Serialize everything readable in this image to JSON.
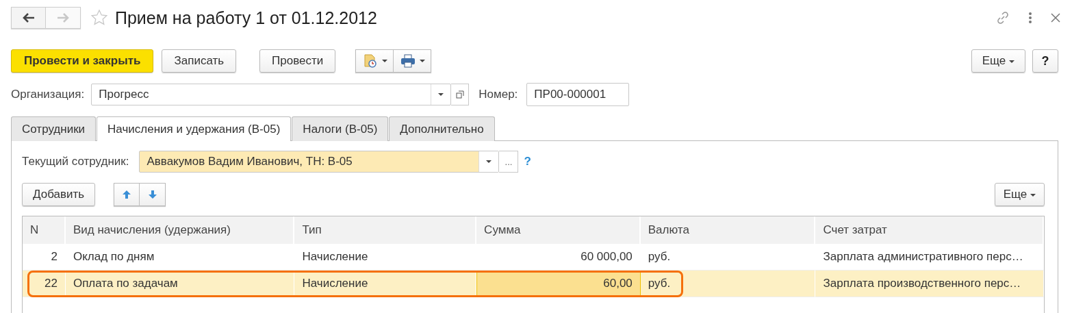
{
  "window": {
    "title": "Прием на работу 1 от 01.12.2012",
    "back_disabled": false,
    "forward_disabled": true,
    "favorite": false
  },
  "toolbar": {
    "buttons": [
      {
        "label": "Провести и закрыть",
        "kind": "primary"
      },
      {
        "label": "Записать",
        "kind": "normal"
      },
      {
        "label": "Провести",
        "kind": "normal"
      }
    ],
    "more": "Еще",
    "help": "?"
  },
  "organization": {
    "label": "Организация:",
    "value": "Прогресс"
  },
  "number": {
    "label": "Номер:",
    "value": "ПР00-000001"
  },
  "tabs": [
    {
      "label": "Сотрудники",
      "selected": false
    },
    {
      "label": "Начисления и удержания (В-05)",
      "selected": true
    },
    {
      "label": "Налоги (В-05)",
      "selected": false
    },
    {
      "label": "Дополнительно",
      "selected": false
    }
  ],
  "employee": {
    "label": "Текущий сотрудник:",
    "value": "Аввакумов Вадим Иванович, ТН: В-05",
    "button": "...",
    "help": "?"
  },
  "table_toolbar": {
    "add": "Добавить",
    "more": "Еще"
  },
  "table": {
    "columns": [
      {
        "label": "N",
        "kind": "number"
      },
      {
        "label": "Вид начисления (удержания)",
        "kind": "text"
      },
      {
        "label": "Тип",
        "kind": "text"
      },
      {
        "label": "Сумма",
        "kind": "number"
      },
      {
        "label": "Валюта",
        "kind": "text"
      },
      {
        "label": "Счет затрат",
        "kind": "text"
      }
    ],
    "rows": [
      {
        "selected": false,
        "outlined": false,
        "cells": [
          {
            "text": "2",
            "current": false
          },
          {
            "text": "Оклад по дням",
            "current": false
          },
          {
            "text": "Начисление",
            "current": false
          },
          {
            "text": "60 000,00",
            "current": false
          },
          {
            "text": "руб.",
            "current": false
          },
          {
            "text": "Зарплата административного перс…",
            "current": false
          }
        ]
      },
      {
        "selected": true,
        "outlined": true,
        "cells": [
          {
            "text": "22",
            "current": false
          },
          {
            "text": "Оплата по задачам",
            "current": false
          },
          {
            "text": "Начисление",
            "current": false
          },
          {
            "text": "60,00",
            "current": true
          },
          {
            "text": "руб.",
            "current": false
          },
          {
            "text": "Зарплата производственного перс…",
            "current": false
          }
        ]
      }
    ]
  }
}
